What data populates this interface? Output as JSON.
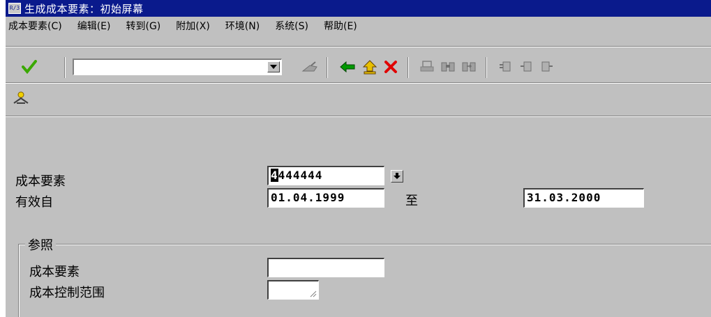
{
  "window": {
    "title": "生成成本要素：初始屏幕",
    "title_icon": "R/3"
  },
  "menu": [
    {
      "label": "成本要素(C)"
    },
    {
      "label": "编辑(E)"
    },
    {
      "label": "转到(G)"
    },
    {
      "label": "附加(X)"
    },
    {
      "label": "环境(N)"
    },
    {
      "label": "系统(S)"
    },
    {
      "label": "帮助(E)"
    }
  ],
  "toolbar": {
    "command_field_value": "",
    "icons": [
      "enter-check-icon",
      "save-icon",
      "back-icon",
      "exit-icon",
      "cancel-icon",
      "print-icon",
      "find-icon",
      "find-next-icon",
      "first-page-icon",
      "previous-page-icon",
      "next-page-icon"
    ]
  },
  "app_toolbar": {
    "icons": [
      "master-data-icon"
    ]
  },
  "form": {
    "cost_element_label": "成本要素",
    "cost_element_value": "4444444",
    "cost_element_caret_char": "4",
    "cost_element_rest": "444444",
    "valid_from_label": "有效自",
    "valid_from_value": "01.04.1999",
    "to_label": "至",
    "valid_to_value": "31.03.2000"
  },
  "reference": {
    "title": "参照",
    "cost_element_label": "成本要素",
    "cost_element_value": "",
    "controlling_area_label": "成本控制范围",
    "controlling_area_value": ""
  },
  "colors": {
    "titlebar": "#0a1a8c",
    "window_bg": "#c0c0c0",
    "check_green": "#3aa800",
    "back_green": "#009900",
    "cancel_red": "#e00000",
    "exit_yellow": "#e8c000"
  }
}
